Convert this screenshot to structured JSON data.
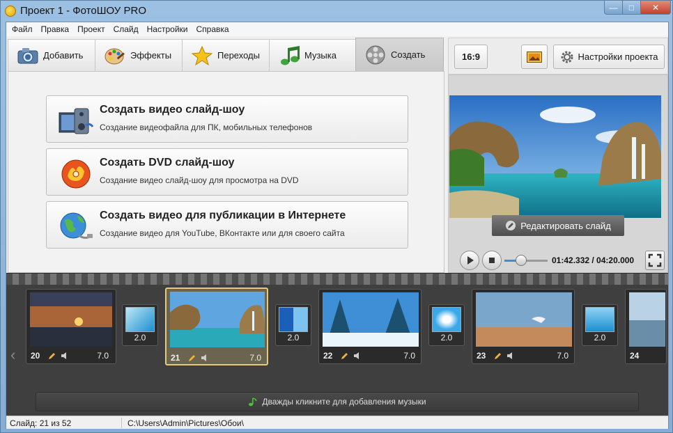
{
  "window": {
    "title": "Проект 1 - ФотоШОУ PRO",
    "controls": {
      "minimize": "—",
      "maximize": "□",
      "close": "✕"
    }
  },
  "menu": [
    "Файл",
    "Правка",
    "Проект",
    "Слайд",
    "Настройки",
    "Справка"
  ],
  "tabs": [
    {
      "label": "Добавить",
      "icon": "camera-icon"
    },
    {
      "label": "Эффекты",
      "icon": "palette-icon"
    },
    {
      "label": "Переходы",
      "icon": "star-icon"
    },
    {
      "label": "Музыка",
      "icon": "music-note-icon"
    },
    {
      "label": "Создать",
      "icon": "film-reel-icon",
      "active": true
    }
  ],
  "actions": [
    {
      "title": "Создать видео слайд-шоу",
      "subtitle": "Создание видеофайла для ПК, мобильных телефонов",
      "icon": "video-file-icon"
    },
    {
      "title": "Создать DVD слайд-шоу",
      "subtitle": "Создание видео слайд-шоу для просмотра на DVD",
      "icon": "dvd-disc-icon"
    },
    {
      "title": "Создать видео для публикации в Интернете",
      "subtitle": "Создание видео для YouTube, ВКонтакте или для своего сайта",
      "icon": "globe-icon"
    }
  ],
  "preview": {
    "aspect_label": "16:9",
    "settings_label": "Настройки проекта",
    "edit_label": "Редактировать слайд",
    "time": "01:42.332 / 04:20.000"
  },
  "timeline": {
    "slides": [
      {
        "num": "20",
        "duration": "7.0",
        "scene": "sunset-sea"
      },
      {
        "num": "21",
        "duration": "7.0",
        "scene": "rocky-coast-waterfall",
        "selected": true
      },
      {
        "num": "22",
        "duration": "7.0",
        "scene": "snowy-forest"
      },
      {
        "num": "23",
        "duration": "7.0",
        "scene": "desert-leaping-person"
      },
      {
        "num": "24",
        "duration": "",
        "scene": "sea-waves"
      }
    ],
    "transitions": [
      "2.0",
      "2.0",
      "2.0",
      "2.0"
    ],
    "music_hint": "Дважды кликните для добавления музыки"
  },
  "status": {
    "slide_info": "Слайд: 21 из 52",
    "path": "C:\\Users\\Admin\\Pictures\\Обои\\"
  },
  "colors": {
    "selected_slide_border": "#e7c97a",
    "timeline_bg": "#3f3f3f",
    "window_frame": "#9cc0e2"
  }
}
